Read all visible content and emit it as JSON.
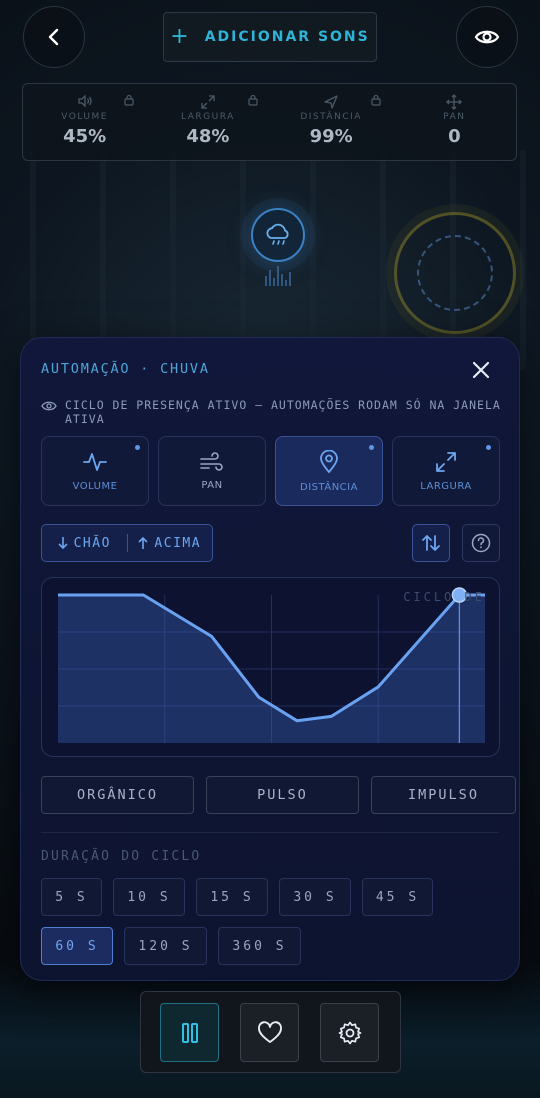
{
  "header": {
    "add_label": "ADICIONAR SONS",
    "back_icon": "chevron-left-icon",
    "eye_icon": "eye-icon"
  },
  "stats": [
    {
      "label": "VOLUME",
      "value": "45%",
      "icon": "volume-icon",
      "locked": true
    },
    {
      "label": "LARGURA",
      "value": "48%",
      "icon": "expand-icon",
      "locked": true
    },
    {
      "label": "DISTÂNCIA",
      "value": "99%",
      "icon": "navigation-icon",
      "locked": true
    },
    {
      "label": "PAN",
      "value": "0",
      "icon": "move-icon",
      "locked": false
    }
  ],
  "panel": {
    "title": "AUTOMAÇÃO · CHUVA",
    "cycle_note": "CICLO DE PRESENÇA ATIVO — AUTOMAÇÕES RODAM SÓ NA JANELA ATIVA",
    "params": [
      {
        "label": "VOLUME",
        "icon": "activity-icon",
        "active": false,
        "dot": true
      },
      {
        "label": "PAN",
        "icon": "wind-icon",
        "active": false,
        "dot": false
      },
      {
        "label": "DISTÂNCIA",
        "icon": "map-pin-icon",
        "active": true,
        "dot": true
      },
      {
        "label": "LARGURA",
        "icon": "expand-icon",
        "active": false,
        "dot": true
      }
    ],
    "direction": {
      "down": "CHÃO",
      "up": "ACIMA"
    },
    "curve_caption": "CICLO DE",
    "curve_points": [
      [
        0,
        1.0
      ],
      [
        0.2,
        1.0
      ],
      [
        0.36,
        0.72
      ],
      [
        0.47,
        0.31
      ],
      [
        0.56,
        0.15
      ],
      [
        0.64,
        0.18
      ],
      [
        0.75,
        0.38
      ],
      [
        0.94,
        1.0
      ],
      [
        1.0,
        1.0
      ]
    ],
    "cursor_position": 0.94,
    "shapes": [
      "ORGÂNICO",
      "PULSO",
      "IMPULSO"
    ],
    "duration_label": "DURAÇÃO DO CICLO",
    "durations_row1": [
      "5 S",
      "10 S",
      "15 S",
      "30 S",
      "45 S"
    ],
    "durations_row2": [
      "60 S",
      "120 S",
      "360 S"
    ],
    "selected_duration": "60 S"
  },
  "dock": {
    "pause_icon": "pause-icon",
    "favorite_icon": "heart-icon",
    "settings_icon": "gear-icon"
  },
  "colors": {
    "accent_cyan": "#2fb3d6",
    "accent_blue": "#5f97e8",
    "panel_bg": "#10173a"
  }
}
